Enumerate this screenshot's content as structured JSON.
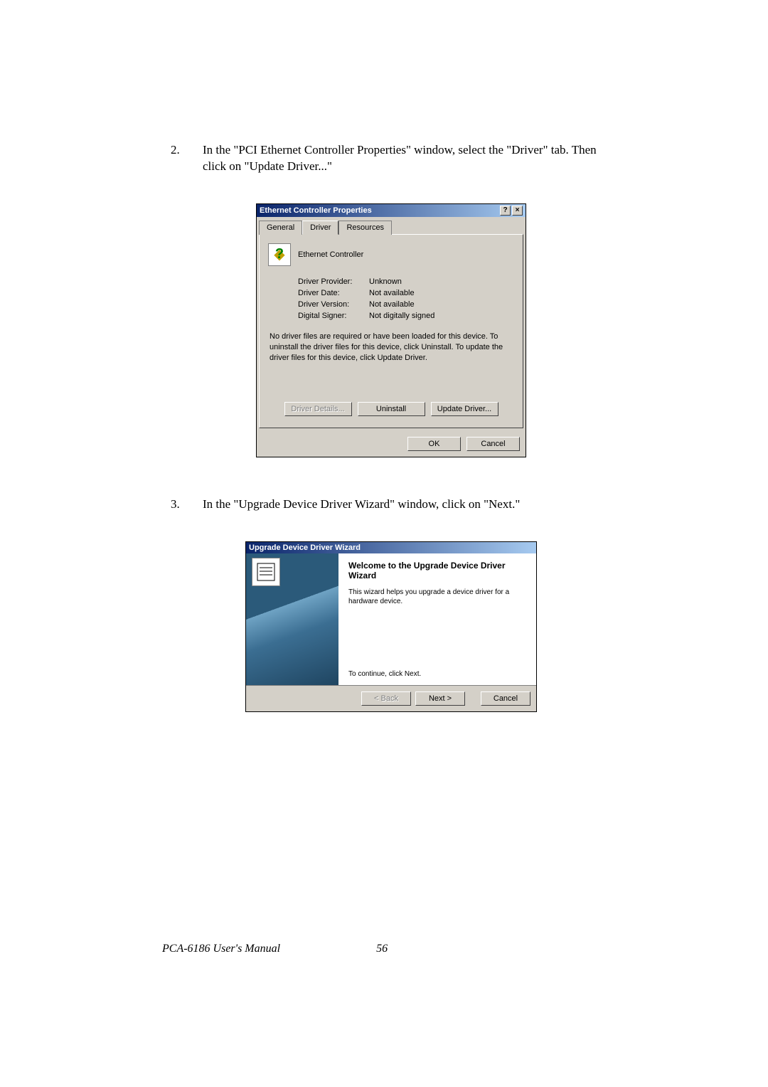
{
  "instruction1": {
    "num": "2.",
    "text": "In the \"PCI Ethernet Controller Properties\" window, select the \"Driver\" tab. Then click on \"Update Driver...\""
  },
  "dialog1": {
    "title": "Ethernet Controller Properties",
    "help": "?",
    "close": "×",
    "tabs": {
      "general": "General",
      "driver": "Driver",
      "resources": "Resources"
    },
    "device_name": "Ethernet Controller",
    "rows": {
      "provider_label": "Driver Provider:",
      "provider_value": "Unknown",
      "date_label": "Driver Date:",
      "date_value": "Not available",
      "version_label": "Driver Version:",
      "version_value": "Not available",
      "signer_label": "Digital Signer:",
      "signer_value": "Not digitally signed"
    },
    "info_text": "No driver files are required or have been loaded for this device. To uninstall the driver files for this device, click Uninstall. To update the driver files for this device, click Update Driver.",
    "buttons": {
      "details": "Driver Details...",
      "uninstall": "Uninstall",
      "update": "Update Driver...",
      "ok": "OK",
      "cancel": "Cancel"
    }
  },
  "instruction2": {
    "num": "3.",
    "text": "In the \"Upgrade Device Driver Wizard\" window, click on \"Next.\""
  },
  "dialog2": {
    "title": "Upgrade Device Driver Wizard",
    "welcome": "Welcome to the Upgrade Device Driver Wizard",
    "desc": "This wizard helps you upgrade a device driver for a hardware device.",
    "continue": "To continue, click Next.",
    "buttons": {
      "back": "< Back",
      "next": "Next >",
      "cancel": "Cancel"
    }
  },
  "footer": {
    "manual": "PCA-6186 User's Manual",
    "page": "56"
  }
}
